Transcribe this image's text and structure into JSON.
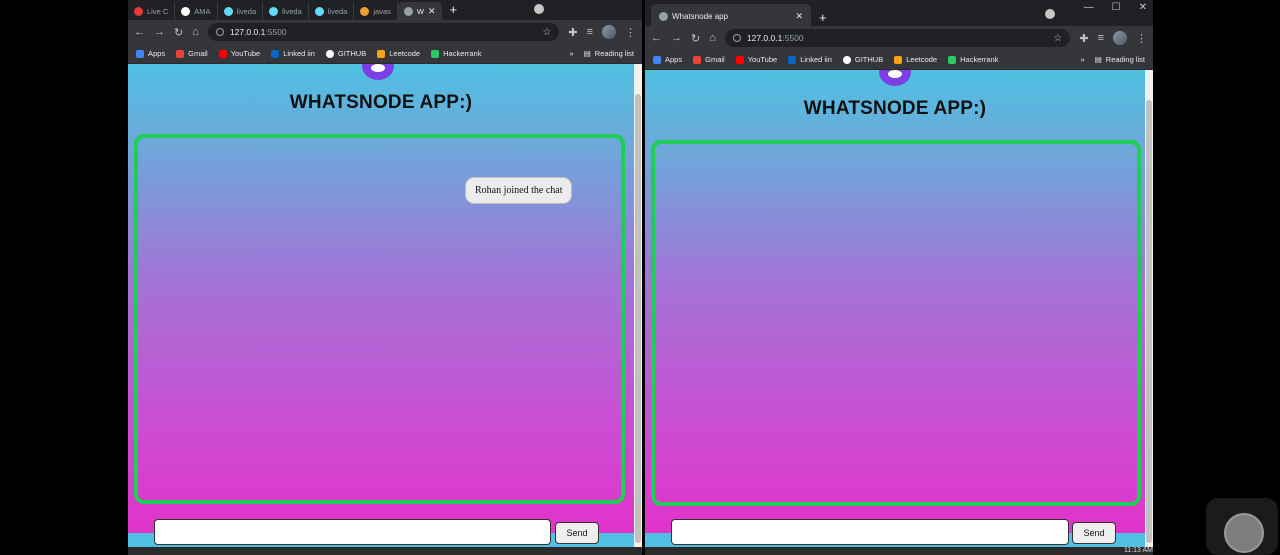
{
  "left_window": {
    "tabs": [
      {
        "label": "Live C",
        "color": "#e53935"
      },
      {
        "label": "AMA",
        "color": "#ffffff"
      },
      {
        "label": "liveda",
        "color": "#61dafb"
      },
      {
        "label": "liveda",
        "color": "#61dafb"
      },
      {
        "label": "liveda",
        "color": "#61dafb"
      },
      {
        "label": "javas",
        "color": "#f0a030"
      },
      {
        "label": "W",
        "color": "#9aa0a6"
      }
    ],
    "url_host": "127.0.0.1",
    "url_port": ":5500",
    "bookmarks": [
      "Apps",
      "Gmail",
      "YouTube",
      "Linked iin",
      "GITHUB",
      "Leetcode",
      "Hackerrank"
    ],
    "more": "»",
    "reading_list": "Reading list",
    "app_title": "WHATSNODE APP:)",
    "notification": "Rohan joined the chat",
    "send_label": "Send"
  },
  "right_window": {
    "tab_title": "Whatsnode app",
    "url_host": "127.0.0.1",
    "url_port": ":5500",
    "bookmarks": [
      "Apps",
      "Gmail",
      "YouTube",
      "Linked iin",
      "GITHUB",
      "Leetcode",
      "Hackerrank"
    ],
    "more": "»",
    "reading_list": "Reading list",
    "app_title": "WHATSNODE APP:)",
    "send_label": "Send",
    "clock": "11:13 AM"
  },
  "colors": {
    "chat_border": "#1fce55",
    "logo": "#7b3fe4"
  }
}
